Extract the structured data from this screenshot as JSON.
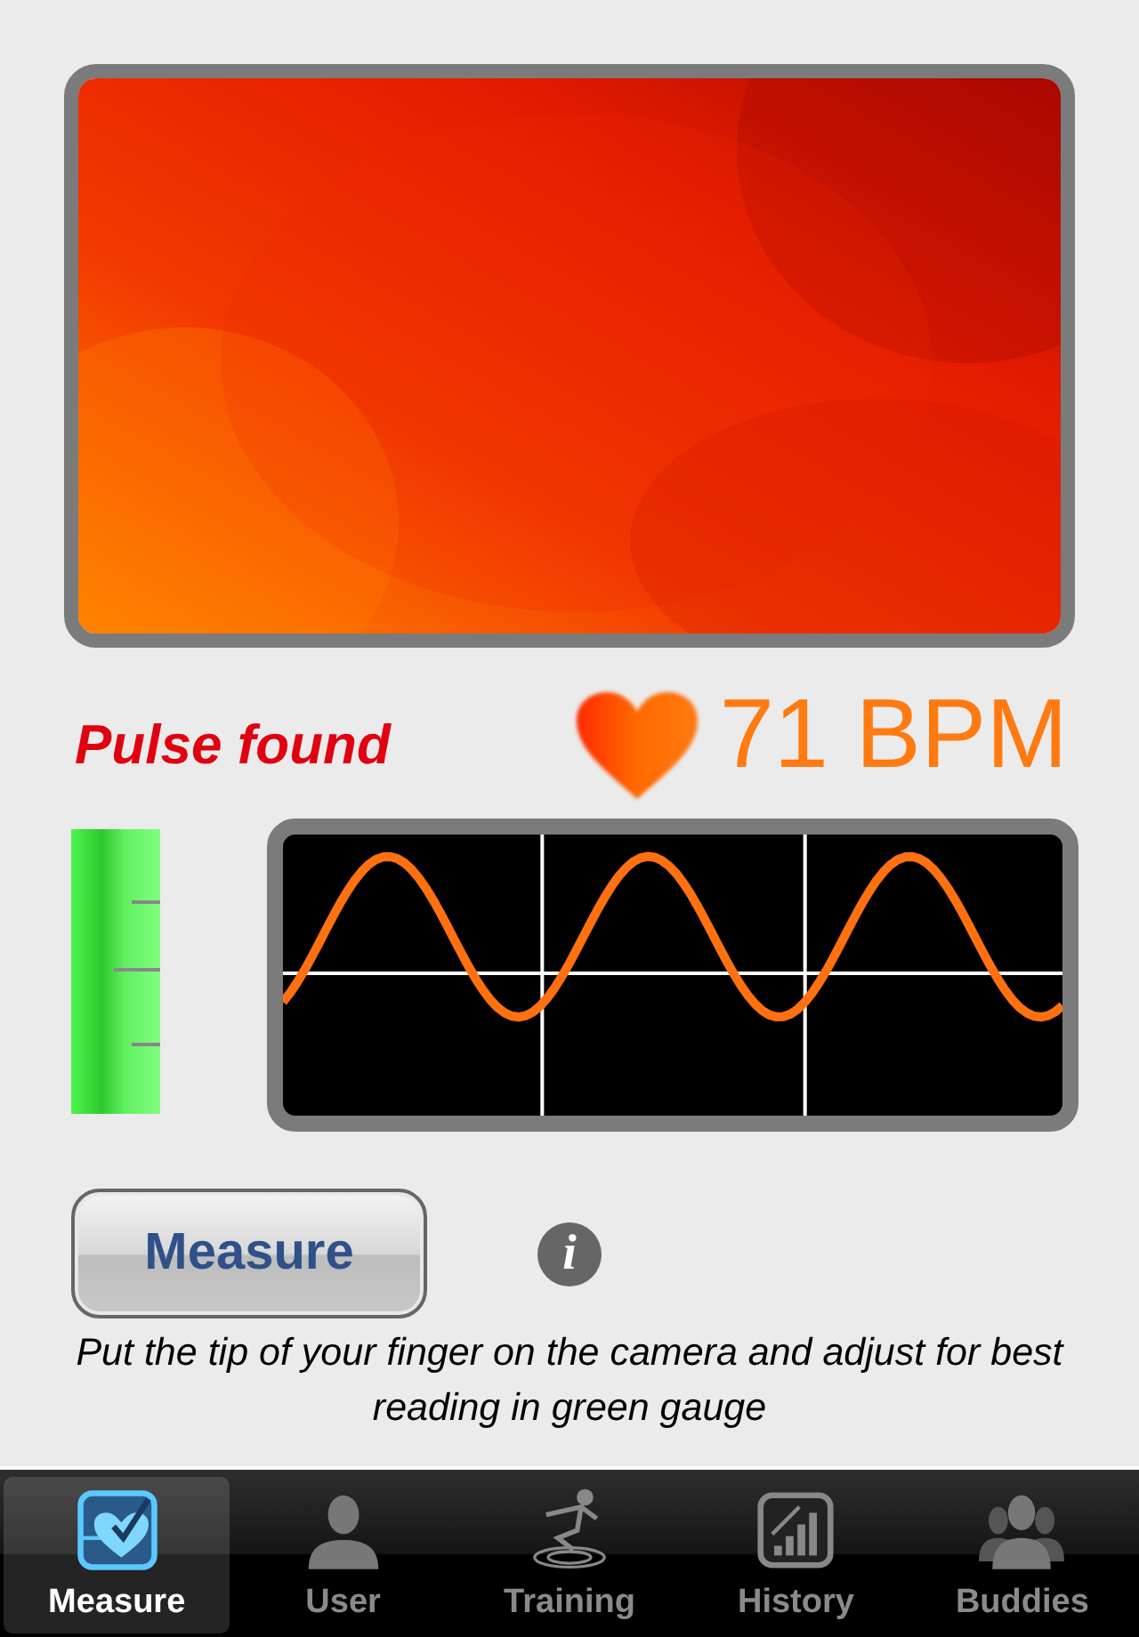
{
  "status": {
    "text": "Pulse found",
    "heart_rate": "71 BPM"
  },
  "measure_button": {
    "label": "Measure"
  },
  "info_button": {
    "label": "i"
  },
  "instruction": "Put the tip of your finger on the camera and adjust for best reading in green gauge",
  "tabs": [
    {
      "label": "Measure",
      "kind": "measure",
      "selected": true
    },
    {
      "label": "User",
      "kind": "user",
      "selected": false
    },
    {
      "label": "Training",
      "kind": "training",
      "selected": false
    },
    {
      "label": "History",
      "kind": "history",
      "selected": false
    },
    {
      "label": "Buddies",
      "kind": "buddies",
      "selected": false
    }
  ]
}
